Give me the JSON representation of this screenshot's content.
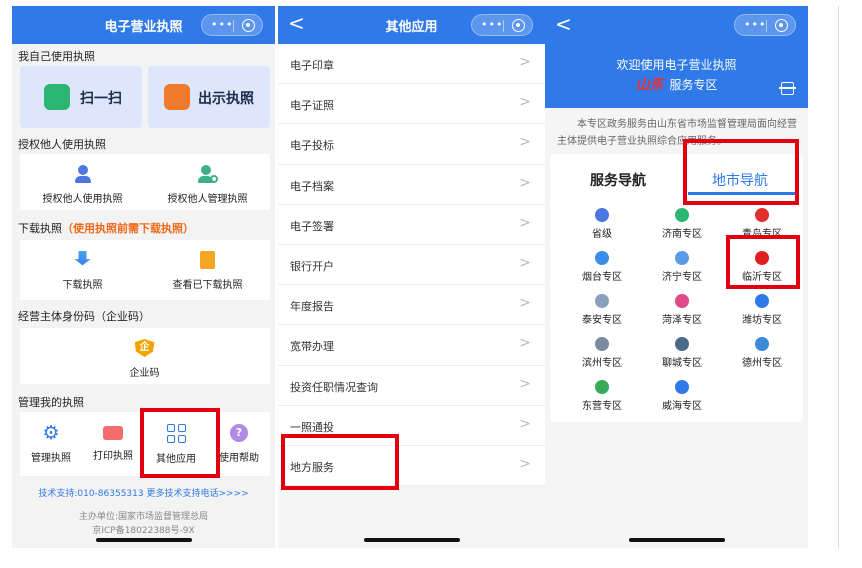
{
  "panel1": {
    "header_title": "电子营业执照",
    "sections": {
      "self_use": "我自己使用执照",
      "authorize": "授权他人使用执照",
      "download": "下载执照",
      "download_note": "（使用执照前需下载执照）",
      "entity_code": "经营主体身份码（企业码）",
      "manage": "管理我的执照"
    },
    "scan_label": "扫一扫",
    "show_label": "出示执照",
    "authorize_items": [
      "授权他人使用执照",
      "授权他人管理执照"
    ],
    "download_items": [
      "下载执照",
      "查看已下载执照"
    ],
    "entity_code_item": "企业码",
    "entity_code_glyph": "企",
    "manage_items": [
      "管理执照",
      "打印执照",
      "其他应用",
      "使用帮助"
    ],
    "help_glyph": "?",
    "support_text": "技术支持:010-86355313",
    "support_more": "更多技术支持电话>>>>",
    "sponsor": "主办单位:国家市场监督管理总局",
    "icp": "京ICP备18022388号-9X"
  },
  "panel2": {
    "header_title": "其他应用",
    "back_glyph": "<",
    "items": [
      "电子印章",
      "电子证照",
      "电子投标",
      "电子档案",
      "电子签署",
      "银行开户",
      "年度报告",
      "宽带办理",
      "投资任职情况查询",
      "一照通投",
      "地方服务"
    ],
    "chevron": ">"
  },
  "panel3": {
    "back_glyph": "<",
    "welcome": "欢迎使用电子营业执照",
    "province": "山东",
    "zone": "服务专区",
    "intro": "本专区政务服务由山东省市场监督管理局面向经营主体提供电子营业执照综合应用服务。",
    "tabs": [
      "服务导航",
      "地市导航"
    ],
    "cities": [
      "省级",
      "济南专区",
      "青岛专区",
      "烟台专区",
      "济宁专区",
      "临沂专区",
      "泰安专区",
      "菏泽专区",
      "潍坊专区",
      "滨州专区",
      "聊城专区",
      "德州专区",
      "东营专区",
      "威海专区"
    ]
  },
  "capsule_dots": "•••",
  "colors": {
    "header_blue": "#2f79e8",
    "highlight_red": "#e0000f",
    "warning_orange": "#f06a1a",
    "province_red": "#ff2a2a"
  }
}
